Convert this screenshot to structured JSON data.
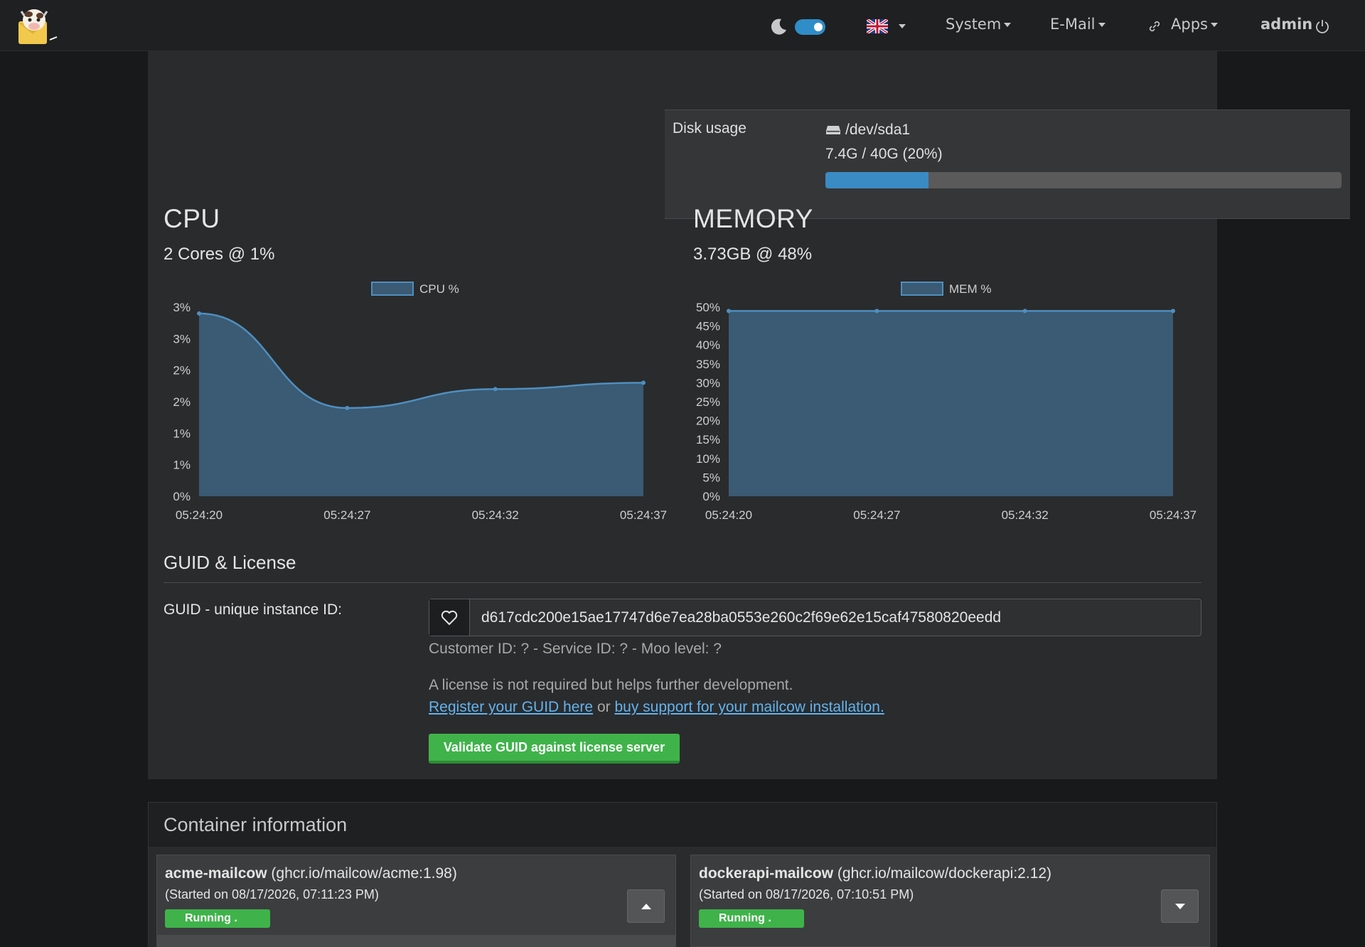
{
  "nav": {
    "menu_system": "System",
    "menu_email": "E-Mail",
    "menu_apps": "Apps",
    "user": "admin",
    "accent_color": "#2f8dc7",
    "icons": [
      "cow-logo",
      "moon-icon",
      "theme-toggle",
      "uk-flag-icon",
      "link-icon",
      "power-icon"
    ]
  },
  "disk": {
    "label": "Disk usage",
    "device": "/dev/sda1",
    "usage": "7.4G / 40G (20%)",
    "percent": 20
  },
  "cpu": {
    "title": "CPU",
    "subtitle": "2 Cores @ 1%"
  },
  "memory": {
    "title": "MEMORY",
    "subtitle": "3.73GB @ 48%"
  },
  "chart_data": [
    {
      "type": "area",
      "legend": "CPU %",
      "x": [
        "05:24:20",
        "05:24:27",
        "05:24:32",
        "05:24:37"
      ],
      "y": [
        2.9,
        1.4,
        1.7,
        1.8
      ],
      "y_ticks": [
        "0%",
        "1%",
        "1%",
        "2%",
        "2%",
        "3%",
        "3%"
      ],
      "ylim": [
        0,
        3
      ],
      "legend_position": "top-center",
      "color": "#3b5a73"
    },
    {
      "type": "area",
      "legend": "MEM %",
      "x": [
        "05:24:20",
        "05:24:27",
        "05:24:32",
        "05:24:37"
      ],
      "y": [
        49,
        49,
        49,
        49
      ],
      "y_ticks": [
        "0%",
        "5%",
        "10%",
        "15%",
        "20%",
        "25%",
        "30%",
        "35%",
        "40%",
        "45%",
        "50%"
      ],
      "ylim": [
        0,
        50
      ],
      "legend_position": "top-center",
      "color": "#3b5a73"
    }
  ],
  "guid": {
    "heading": "GUID & License",
    "label": "GUID - unique instance ID:",
    "value": "d617cdc200e15ae17747d6e7ea28ba0553e260c2f69e62e15caf47580820eedd",
    "meta": "Customer ID: ? - Service ID: ? - Moo level: ?",
    "license_text": "A license is not required but helps further development.",
    "link_register": "Register your GUID here",
    "link_or": "or",
    "link_support": "buy support for your mailcow installation.",
    "validate_button": "Validate GUID against license server"
  },
  "containers": {
    "title": "Container information",
    "items": [
      {
        "name": "acme-mailcow",
        "image": "(ghcr.io/mailcow/acme:1.98)",
        "started": "(Started on 08/17/2026, 07:11:23 PM)",
        "status": "Running ."
      },
      {
        "name": "dockerapi-mailcow",
        "image": "(ghcr.io/mailcow/dockerapi:2.12)",
        "started": "(Started on 08/17/2026, 07:10:51 PM)",
        "status": "Running ."
      }
    ]
  }
}
